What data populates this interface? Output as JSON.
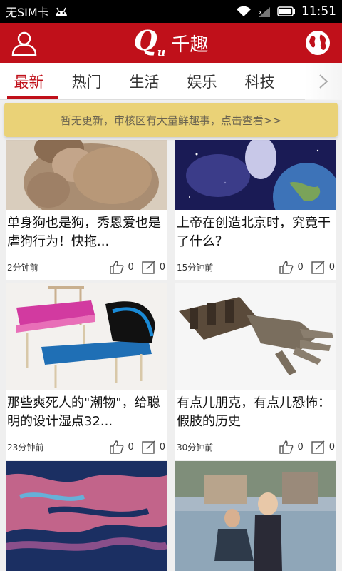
{
  "status_bar": {
    "carrier": "无SIM卡",
    "time": "11:51"
  },
  "header": {
    "logo_text": "Q",
    "logo_sub": "u",
    "app_name": "千趣"
  },
  "tabs": [
    {
      "label": "最新",
      "active": true
    },
    {
      "label": "热门",
      "active": false
    },
    {
      "label": "生活",
      "active": false
    },
    {
      "label": "娱乐",
      "active": false
    },
    {
      "label": "科技",
      "active": false
    }
  ],
  "notice": "暂无更新，审核区有大量鲜趣事，点击查看>>",
  "cards": [
    {
      "title": "单身狗也是狗，秀恩爱也是虐狗行为！快拖...",
      "time": "2分钟前",
      "likes": "0",
      "shares": "0",
      "image": "monkey-photo"
    },
    {
      "title": "上帝在创造北京时，究竟干了什么？",
      "time": "15分钟前",
      "likes": "0",
      "shares": "0",
      "image": "space-earth-photo"
    },
    {
      "title": "那些爽死人的\"潮物\"，给聪明的设计湿点32...",
      "time": "23分钟前",
      "likes": "0",
      "shares": "0",
      "image": "chair-design-photo"
    },
    {
      "title": "有点儿朋克，有点儿恐怖：假肢的历史",
      "time": "30分钟前",
      "likes": "0",
      "shares": "0",
      "image": "prosthetic-arm-photo"
    },
    {
      "title": "",
      "time": "",
      "likes": "",
      "shares": "",
      "image": "satellite-map-photo"
    },
    {
      "title": "",
      "time": "",
      "likes": "",
      "shares": "",
      "image": "proposal-photo"
    }
  ],
  "colors": {
    "brand_red": "#c0101a",
    "notice_bg": "#e9d070"
  }
}
